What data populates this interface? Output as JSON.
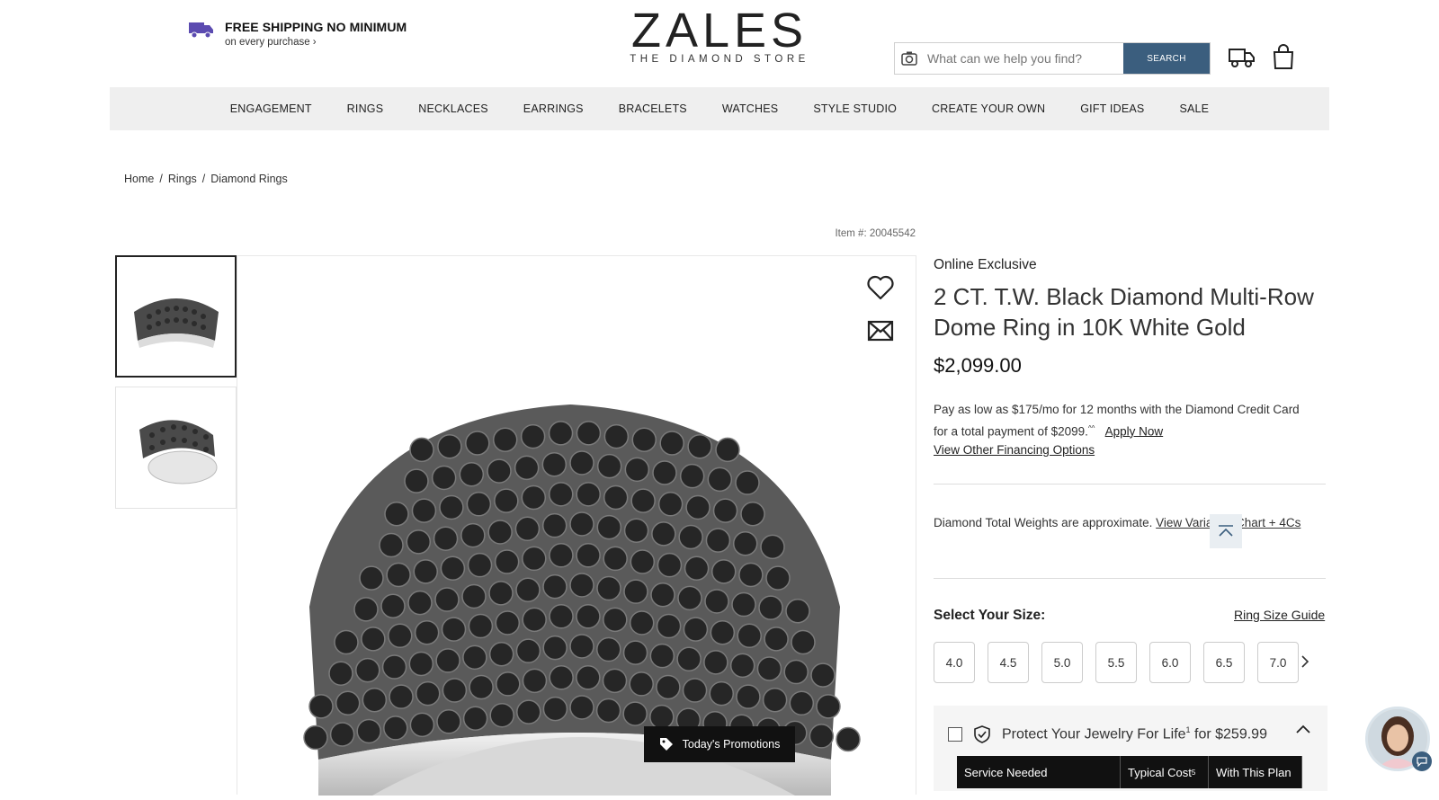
{
  "shipping": {
    "title": "FREE SHIPPING NO MINIMUM",
    "subtitle": "on every purchase ›",
    "icon": "truck-icon"
  },
  "logo": {
    "word": "ZALES",
    "tagline": "THE DIAMOND STORE"
  },
  "search": {
    "placeholder": "What can we help you find?",
    "button": "SEARCH"
  },
  "nav": [
    "ENGAGEMENT",
    "RINGS",
    "NECKLACES",
    "EARRINGS",
    "BRACELETS",
    "WATCHES",
    "STYLE STUDIO",
    "CREATE YOUR OWN",
    "GIFT IDEAS",
    "SALE"
  ],
  "breadcrumb": [
    "Home",
    "Rings",
    "Diamond Rings"
  ],
  "item_number": "Item #: 20045542",
  "product": {
    "badge": "Online Exclusive",
    "title": "2 CT. T.W. Black Diamond Multi-Row Dome Ring in 10K White Gold",
    "price": "$2,099.00",
    "financing_text": "Pay as low as $175/mo for 12 months with the Diamond Credit Card for a total payment of $2099.",
    "financing_sup": "^^",
    "apply_now": "Apply Now",
    "other_financing": "View Other Financing Options",
    "approx_text": "Diamond Total Weights are approximate.",
    "approx_link": "View Variance Chart + 4Cs"
  },
  "size": {
    "label": "Select Your Size:",
    "guide": "Ring Size Guide",
    "options": [
      "4.0",
      "4.5",
      "5.0",
      "5.5",
      "6.0",
      "6.5",
      "7.0"
    ]
  },
  "protect": {
    "label": "Protect Your Jewelry For Life",
    "sup": "1",
    "price": "for $259.99",
    "table": {
      "col1": "Service Needed",
      "col2": "Typical Cost",
      "col2_sup": "5",
      "col3": "With This Plan"
    }
  },
  "promotions": "Today's Promotions"
}
